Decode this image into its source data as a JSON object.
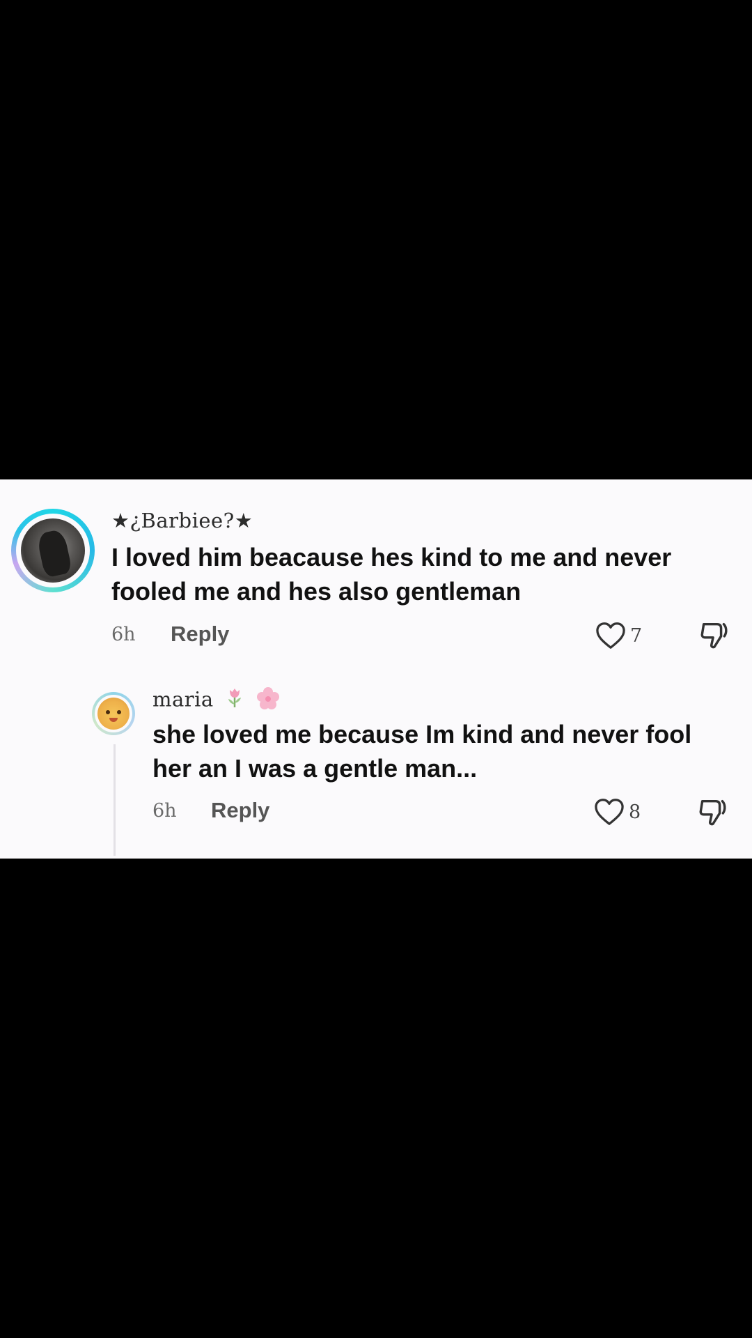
{
  "comment": {
    "username": "★¿Barbiee?★",
    "text_line1": "I loved him beacause hes kind to me and never",
    "text_line2": "fooled me and hes also gentleman",
    "time": "6h",
    "reply_label": "Reply",
    "likes": "7",
    "icons": {
      "avatar": "profile-photo-avatar",
      "like": "heart-outline-icon",
      "dislike": "thumbs-down-icon"
    }
  },
  "reply": {
    "username": "maria",
    "username_emojis": [
      "tulip-emoji",
      "cherry-blossom-emoji"
    ],
    "text_line1": "she loved me because Im kind and never fool",
    "text_line2": "her an I was a gentle man...",
    "time": "6h",
    "reply_label": "Reply",
    "likes": "8",
    "icons": {
      "avatar": "emoji-face-avatar",
      "like": "heart-outline-icon",
      "dislike": "thumbs-down-icon"
    }
  },
  "colors": {
    "panel_bg": "#fbfafc",
    "screen_bg": "#000000",
    "text_primary": "#111111",
    "text_secondary": "#555555",
    "avatar_ring": "#1fd6e6"
  }
}
